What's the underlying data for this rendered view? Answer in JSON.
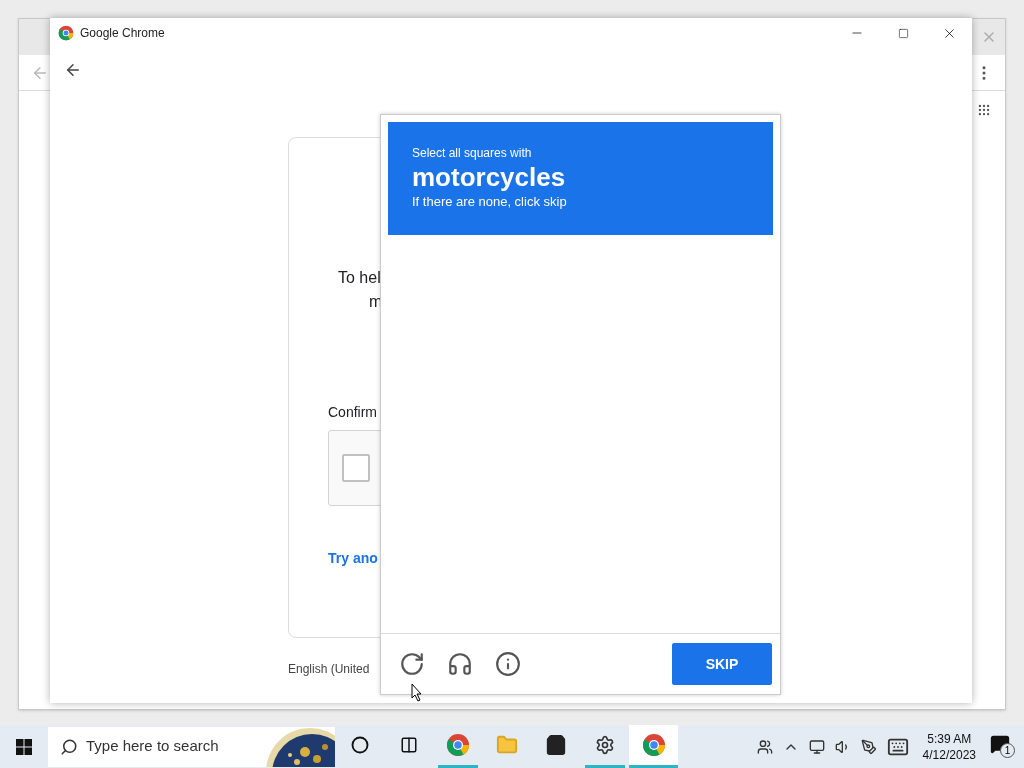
{
  "window": {
    "title": "Google Chrome"
  },
  "page": {
    "card": {
      "text_lines": [
        "To hel",
        "m"
      ],
      "confirm_label": "Confirm",
      "checkbox": {
        "checked": false
      },
      "link": "Try ano"
    },
    "language": "English (United"
  },
  "captcha": {
    "prompt": "Select all squares with",
    "target": "motorcycles",
    "hint": "If there are none, click skip",
    "button": "SKIP"
  },
  "taskbar": {
    "search": {
      "placeholder": "Type here to search"
    },
    "apps": [
      {
        "kind": "cortana",
        "running": false,
        "selected": false
      },
      {
        "kind": "task-view",
        "running": false,
        "selected": false
      },
      {
        "kind": "chrome-profile",
        "running": true,
        "selected": false
      },
      {
        "kind": "file-explorer",
        "running": false,
        "selected": false
      },
      {
        "kind": "store",
        "running": false,
        "selected": false
      },
      {
        "kind": "settings",
        "running": true,
        "selected": false
      },
      {
        "kind": "chrome",
        "running": true,
        "selected": true
      }
    ],
    "time": "5:39 AM",
    "date": "4/12/2023",
    "notifications": "1"
  }
}
